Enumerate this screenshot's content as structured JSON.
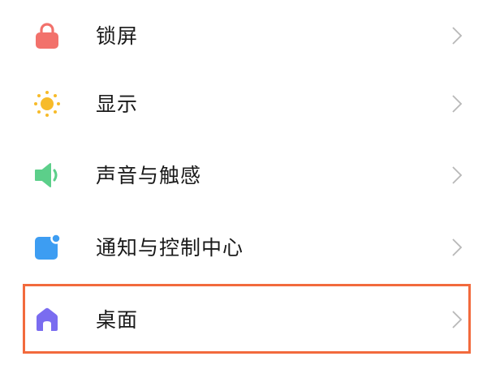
{
  "settings": {
    "items": [
      {
        "label": "锁屏",
        "icon": "lock-icon",
        "color": "#f2716b"
      },
      {
        "label": "显示",
        "icon": "sun-icon",
        "color": "#f7bb2a"
      },
      {
        "label": "声音与触感",
        "icon": "speaker-icon",
        "color": "#5ccf8a"
      },
      {
        "label": "通知与控制中心",
        "icon": "notification-icon",
        "color": "#3d9df2"
      },
      {
        "label": "桌面",
        "icon": "home-icon",
        "color": "#7a6cf0",
        "highlighted": true
      }
    ],
    "chevron_color": "#b8b8b8",
    "highlight_color": "#f26a3d"
  }
}
